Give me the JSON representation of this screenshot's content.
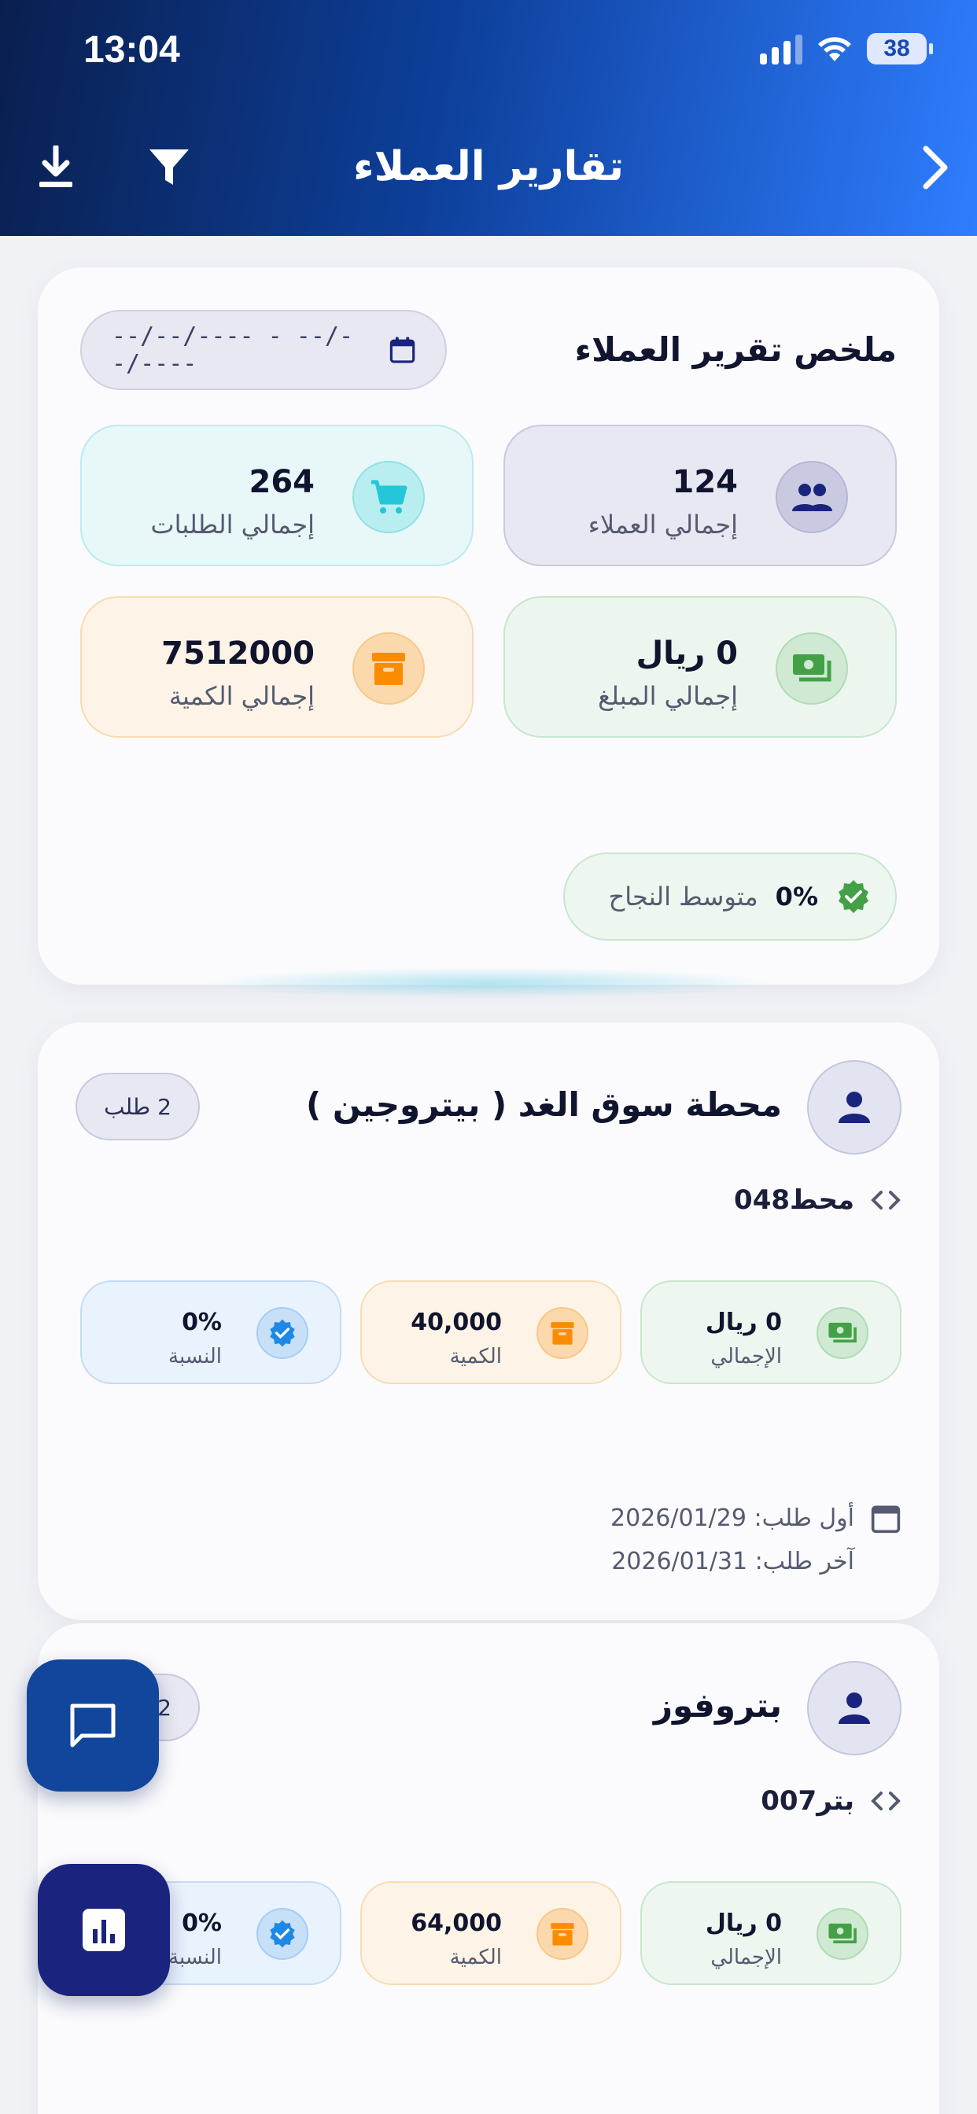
{
  "status_bar": {
    "time": "13:04",
    "battery": "38"
  },
  "header": {
    "title": "تقارير العملاء"
  },
  "summary": {
    "title": "ملخص تقرير العملاء",
    "date_range": "--/--/---- - --/--/----",
    "stats": {
      "customers": {
        "value": "124",
        "label": "إجمالي العملاء"
      },
      "orders": {
        "value": "264",
        "label": "إجمالي الطلبات"
      },
      "amount": {
        "value": "0 ريال",
        "label": "إجمالي المبلغ"
      },
      "quantity": {
        "value": "7512000",
        "label": "إجمالي الكمية"
      }
    },
    "success": {
      "value": "0%",
      "label": "متوسط النجاح"
    }
  },
  "customers": [
    {
      "name": "محطة سوق الغد ( بيتروجين )",
      "orders": "2 طلب",
      "code": "محط048",
      "total": {
        "value": "0 ريال",
        "label": "الإجمالي"
      },
      "quantity": {
        "value": "40,000",
        "label": "الكمية"
      },
      "rate": {
        "value": "0%",
        "label": "النسبة"
      },
      "first_order": "أول طلب: 2026/01/29",
      "last_order": "آخر طلب: 2026/01/31"
    },
    {
      "name": "بتروفوز",
      "orders": "2 طلب",
      "code": "بتر007",
      "total": {
        "value": "0 ريال",
        "label": "الإجمالي"
      },
      "quantity": {
        "value": "64,000",
        "label": "الكمية"
      },
      "rate": {
        "value": "0%",
        "label": "النسبة"
      }
    }
  ],
  "icons": {
    "back": "chevron-right-icon",
    "filter": "filter-icon",
    "download": "download-icon",
    "calendar": "calendar-icon",
    "customers": "users-icon",
    "orders": "cart-icon",
    "amount": "cash-icon",
    "quantity": "box-icon",
    "success": "verified-badge-icon",
    "avatar": "person-icon",
    "code": "code-icon",
    "chat": "chat-icon",
    "report": "bar-chart-icon"
  },
  "colors": {
    "header_start": "#0a1f4f",
    "header_end": "#2f7dff",
    "accent_navy": "#1a237e",
    "green": "#43a047",
    "orange": "#fb8c00",
    "teal": "#26c6da",
    "blue": "#1e88e5"
  }
}
